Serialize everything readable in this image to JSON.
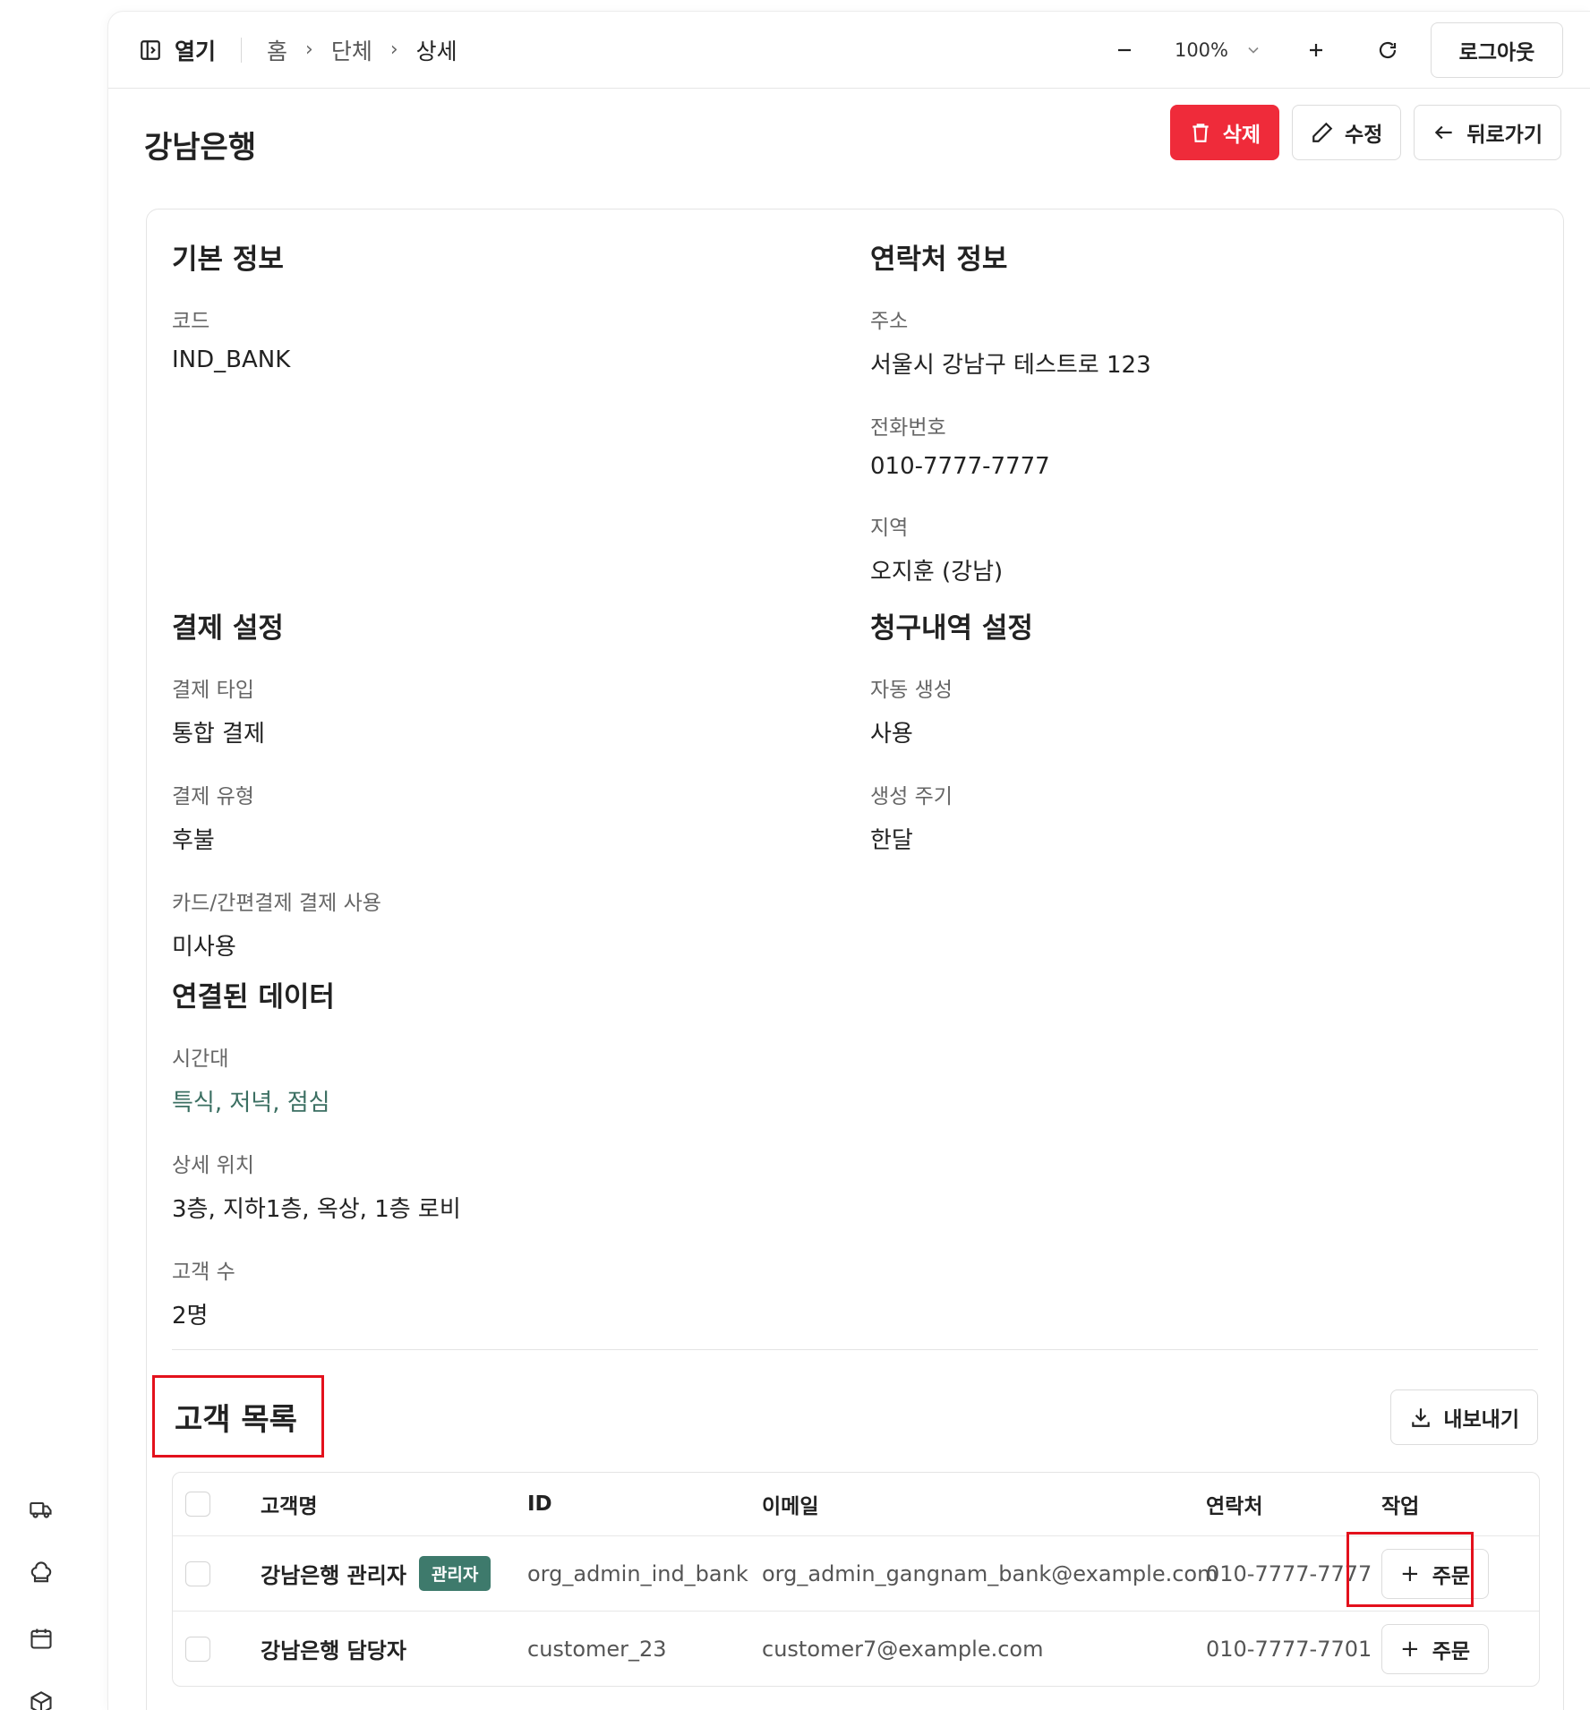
{
  "colors": {
    "accent": "#3e7a6c",
    "danger": "#ef2b3a",
    "highlight": "#e3111c",
    "link": "#3b6f62"
  },
  "rail": {
    "icons": [
      "truck-icon",
      "chef-hat-icon",
      "calendar-icon",
      "package-icon"
    ]
  },
  "topbar": {
    "open_label": "열기",
    "breadcrumbs": [
      "홈",
      "단체",
      "상세"
    ],
    "zoom": "100%",
    "logout_label": "로그아웃"
  },
  "page": {
    "title": "강남은행",
    "delete_label": "삭제",
    "edit_label": "수정",
    "back_label": "뒤로가기"
  },
  "basic": {
    "heading": "기본 정보",
    "code_label": "코드",
    "code_value": "IND_BANK"
  },
  "contact": {
    "heading": "연락처 정보",
    "address_label": "주소",
    "address_value": "서울시 강남구 테스트로 123",
    "phone_label": "전화번호",
    "phone_value": "010-7777-7777",
    "region_label": "지역",
    "region_value": "오지훈 (강남)"
  },
  "payment": {
    "heading": "결제 설정",
    "type_label": "결제 타입",
    "type_value": "통합 결제",
    "kind_label": "결제 유형",
    "kind_value": "후불",
    "card_label": "카드/간편결제 결제 사용",
    "card_value": "미사용"
  },
  "billing": {
    "heading": "청구내역 설정",
    "auto_label": "자동 생성",
    "auto_value": "사용",
    "cycle_label": "생성 주기",
    "cycle_value": "한달"
  },
  "linked": {
    "heading": "연결된 데이터",
    "time_label": "시간대",
    "time_items": [
      "특식",
      "저녁",
      "점심"
    ],
    "location_label": "상세 위치",
    "location_value": "3층, 지하1층, 옥상, 1층 로비",
    "count_label": "고객 수",
    "count_value": "2명"
  },
  "customers": {
    "heading": "고객 목록",
    "export_label": "내보내기",
    "columns": {
      "name": "고객명",
      "id": "ID",
      "email": "이메일",
      "phone": "연락처",
      "action": "작업"
    },
    "rows": [
      {
        "name": "강남은행 관리자",
        "badge": "관리자",
        "id": "org_admin_ind_bank",
        "email": "org_admin_gangnam_bank@example.com",
        "phone": "010-7777-7777",
        "action": "주문",
        "action_icon": "+"
      },
      {
        "name": "강남은행 담당자",
        "id": "customer_23",
        "email": "customer7@example.com",
        "phone": "010-7777-7701",
        "action": "주문",
        "action_icon": "+"
      }
    ]
  }
}
